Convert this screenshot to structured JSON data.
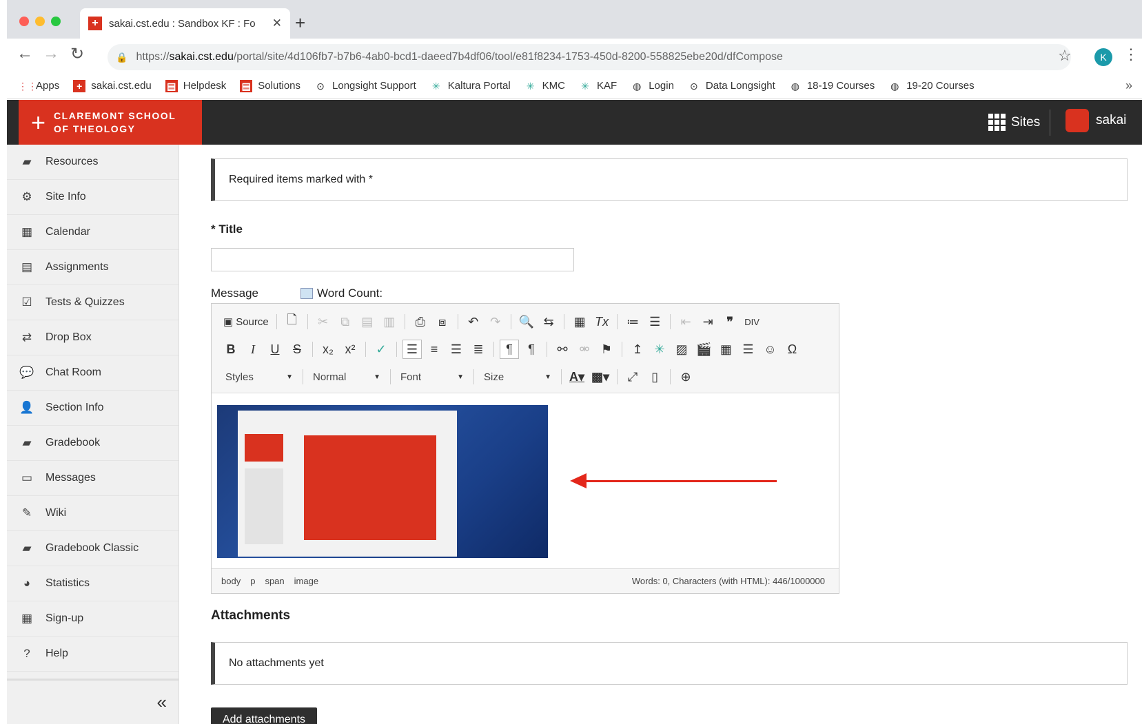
{
  "browser": {
    "tab_title": "sakai.cst.edu : Sandbox KF : Fo",
    "url_scheme": "https://",
    "url_host": "sakai.cst.edu",
    "url_path": "/portal/site/4d106fb7-b7b6-4ab0-bcd1-daeed7b4df06/tool/e81f8234-1753-450d-8200-558825ebe20d/dfCompose",
    "profile_initial": "K"
  },
  "bookmarks": [
    {
      "label": "Apps",
      "icon": "apps-grid-icon"
    },
    {
      "label": "sakai.cst.edu",
      "icon": "cst-logo-icon"
    },
    {
      "label": "Helpdesk",
      "icon": "helpdesk-icon"
    },
    {
      "label": "Solutions",
      "icon": "solutions-icon"
    },
    {
      "label": "Longsight Support",
      "icon": "longsight-icon"
    },
    {
      "label": "Kaltura Portal",
      "icon": "kaltura-icon"
    },
    {
      "label": "KMC",
      "icon": "kaltura-icon"
    },
    {
      "label": "KAF",
      "icon": "kaltura-icon"
    },
    {
      "label": "Login",
      "icon": "globe-icon"
    },
    {
      "label": "Data Longsight",
      "icon": "circle-icon"
    },
    {
      "label": "18-19 Courses",
      "icon": "globe-icon"
    },
    {
      "label": "19-20 Courses",
      "icon": "globe-icon"
    }
  ],
  "header": {
    "logo_text": "CLAREMONT SCHOOL\nOF THEOLOGY",
    "sites_label": "Sites",
    "user_label": "sakai"
  },
  "sidebar": {
    "items": [
      {
        "label": "Resources",
        "icon": "folder-icon"
      },
      {
        "label": "Site Info",
        "icon": "gear-icon"
      },
      {
        "label": "Calendar",
        "icon": "calendar-icon"
      },
      {
        "label": "Assignments",
        "icon": "document-icon"
      },
      {
        "label": "Tests & Quizzes",
        "icon": "checkbox-icon"
      },
      {
        "label": "Drop Box",
        "icon": "transfer-icon"
      },
      {
        "label": "Chat Room",
        "icon": "chat-icon"
      },
      {
        "label": "Section Info",
        "icon": "user-icon"
      },
      {
        "label": "Gradebook",
        "icon": "book-icon"
      },
      {
        "label": "Messages",
        "icon": "inbox-icon"
      },
      {
        "label": "Wiki",
        "icon": "edit-icon"
      },
      {
        "label": "Gradebook Classic",
        "icon": "book-icon"
      },
      {
        "label": "Statistics",
        "icon": "pie-chart-icon"
      },
      {
        "label": "Sign-up",
        "icon": "calendar-check-icon"
      },
      {
        "label": "Help",
        "icon": "help-icon"
      }
    ]
  },
  "main": {
    "required_notice": "Required items marked with *",
    "title_label": "* Title",
    "title_value": "",
    "message_label": "Message",
    "word_count_label": "Word Count:",
    "editor": {
      "source_label": "Source",
      "styles_label": "Styles",
      "format_label": "Normal",
      "font_label": "Font",
      "size_label": "Size",
      "path": [
        "body",
        "p",
        "span",
        "image"
      ],
      "counts": "Words: 0, Characters (with HTML): 446/1000000"
    },
    "attachments_heading": "Attachments",
    "attachments_empty": "No attachments yet",
    "add_attachments_label": "Add attachments"
  },
  "colors": {
    "brand_red": "#d9321f",
    "header_dark": "#2b2b2b",
    "arrow_red": "#e3271b"
  }
}
